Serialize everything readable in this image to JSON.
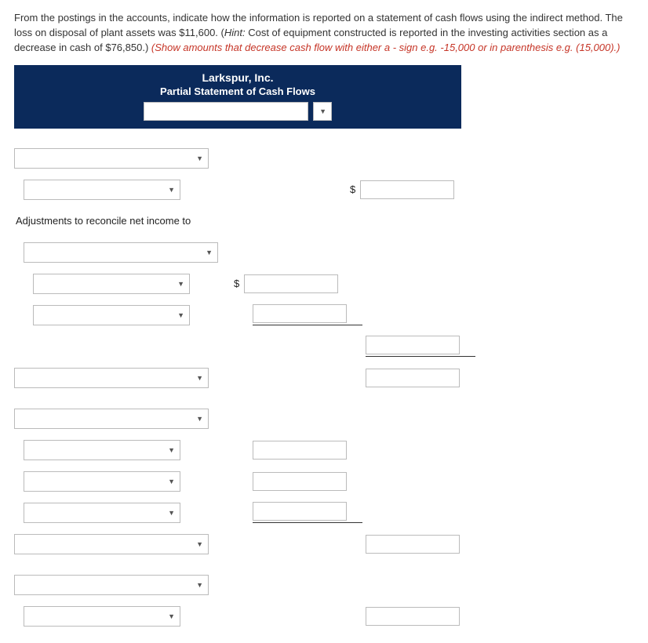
{
  "instructions": {
    "main_a": "From the postings in the accounts, indicate how the information is reported on a statement of cash flows using the indirect method. The loss on disposal of plant assets was $11,600. (",
    "hint_label": "Hint:",
    "hint_body": " Cost of equipment constructed is reported in the investing activities section as a decrease in cash of $76,850.) ",
    "red": "(Show amounts that decrease cash flow with either a - sign e.g. -15,000 or in parenthesis e.g. (15,000).)"
  },
  "header": {
    "company": "Larkspur, Inc.",
    "title": "Partial Statement of Cash Flows",
    "period_value": ""
  },
  "labels": {
    "adjustments": "Adjustments to reconcile net income to"
  },
  "symbols": {
    "dollar": "$"
  },
  "fields": {
    "section1_select": "",
    "line_netincome_select": "",
    "line_netincome_amount": "",
    "adjust_header_select": "",
    "adj1_select": "",
    "adj1_amount": "",
    "adj2_select": "",
    "adj2_amount": "",
    "subtotal_right_a": "",
    "section2_select": "",
    "subtotal_right_b": "",
    "section2_header_select": "",
    "inv1_select": "",
    "inv1_amount": "",
    "inv2_select": "",
    "inv2_amount": "",
    "inv3_select": "",
    "inv3_amount": "",
    "section3_select": "",
    "section3_amount": "",
    "section4_header_select": "",
    "final_select": "",
    "final_amount": ""
  }
}
